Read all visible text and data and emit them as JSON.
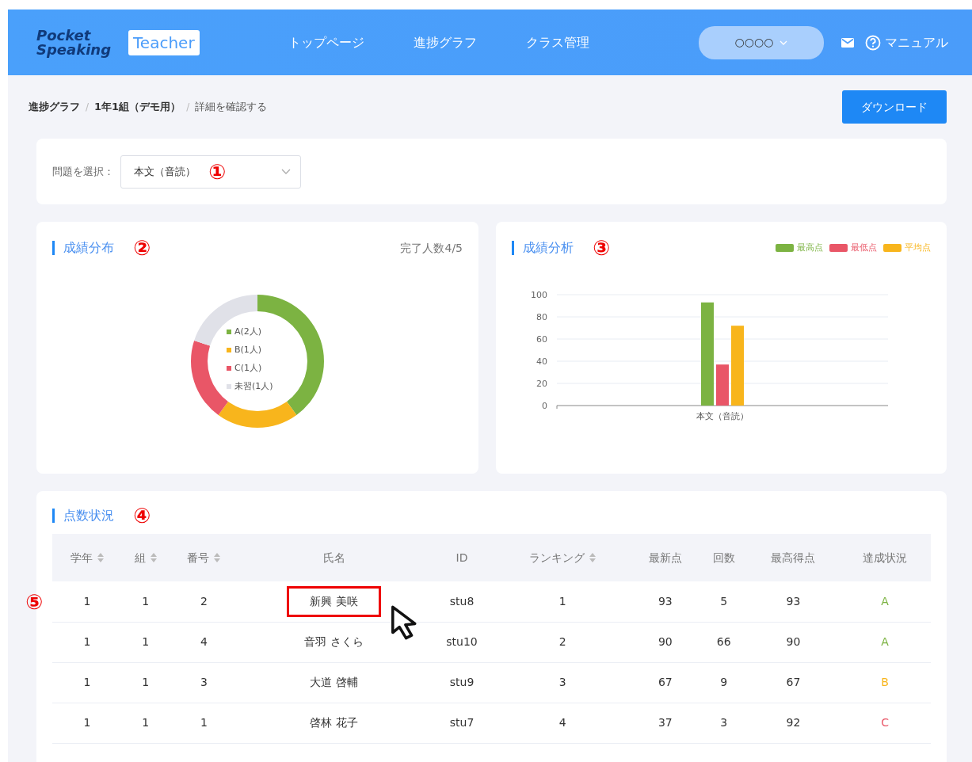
{
  "header": {
    "logo": {
      "line_1": "Pocket",
      "line_2": "Speaking"
    },
    "badge": "Teacher",
    "nav": [
      {
        "label": "トップページ",
        "selected": false
      },
      {
        "label": "進捗グラフ",
        "selected": false
      },
      {
        "label": "クラス管理",
        "selected": false
      }
    ],
    "user_menu": "○○○○",
    "manual": "マニュアル"
  },
  "breadcrumb": [
    {
      "label": "進捗グラフ",
      "current": false
    },
    {
      "separator": "/"
    },
    {
      "label": "1年1組（デモ用）",
      "current": false
    },
    {
      "separator": "/"
    },
    {
      "label": "詳細を確認する",
      "current": true
    }
  ],
  "download_button": "ダウンロード",
  "question_select": {
    "label": "問題を選択：",
    "value": "本文（音読）",
    "annotation": "①"
  },
  "distribution": {
    "title": "成績分布",
    "annotation": "②",
    "completed": "完了人数4/5",
    "chart_data": {
      "type": "donut",
      "legend": true,
      "categories": [
        "A(2人)",
        "B(1人)",
        "C(1人)",
        "未習(1人)"
      ],
      "values": [
        2,
        1,
        1,
        1
      ],
      "colors": [
        "#7cb342",
        "#f8b51c",
        "#e95667",
        "#e0e1e8"
      ]
    }
  },
  "analysis": {
    "title": "成績分析",
    "annotation": "③",
    "chart_data": {
      "type": "bar",
      "grid": true,
      "legend": true,
      "categories": [
        "本文（音読）"
      ],
      "series": [
        {
          "name": "最高点",
          "color": "#7cb342",
          "values": [
            93
          ]
        },
        {
          "name": "最低点",
          "color": "#e95667",
          "values": [
            37
          ]
        },
        {
          "name": "平均点",
          "color": "#f8b51c",
          "values": [
            72
          ]
        }
      ],
      "ylim": [
        0,
        100
      ],
      "yticks": [
        0,
        20,
        40,
        60,
        80,
        100
      ]
    }
  },
  "scores": {
    "title": "点数状況",
    "annotation": "④",
    "row_annotation": "⑤",
    "columns": [
      {
        "label": "学年",
        "sortable": true
      },
      {
        "label": "組",
        "sortable": true
      },
      {
        "label": "番号",
        "sortable": true
      },
      {
        "label": "氏名",
        "sortable": false
      },
      {
        "label": "ID",
        "sortable": false
      },
      {
        "label": "ランキング",
        "sortable": true
      },
      {
        "label": "最新点",
        "sortable": false
      },
      {
        "label": "回数",
        "sortable": false
      },
      {
        "label": "最高得点",
        "sortable": false
      },
      {
        "label": "達成状況",
        "sortable": false
      }
    ],
    "rows": [
      {
        "cells": [
          "1",
          "1",
          "2",
          "新興 美咲",
          "stu8",
          "1",
          "93",
          "5",
          "93",
          "A"
        ],
        "color": "#7cb342",
        "highlighted": true
      },
      {
        "cells": [
          "1",
          "1",
          "4",
          "音羽 さくら",
          "stu10",
          "2",
          "90",
          "66",
          "90",
          "A"
        ],
        "color": "#7cb342",
        "highlighted": false
      },
      {
        "cells": [
          "1",
          "1",
          "3",
          "大道 啓輔",
          "stu9",
          "3",
          "67",
          "9",
          "67",
          "B"
        ],
        "color": "#f8b51c",
        "highlighted": false
      },
      {
        "cells": [
          "1",
          "1",
          "1",
          "啓林 花子",
          "stu7",
          "4",
          "37",
          "3",
          "92",
          "C"
        ],
        "color": "#e95667",
        "highlighted": false
      }
    ]
  }
}
